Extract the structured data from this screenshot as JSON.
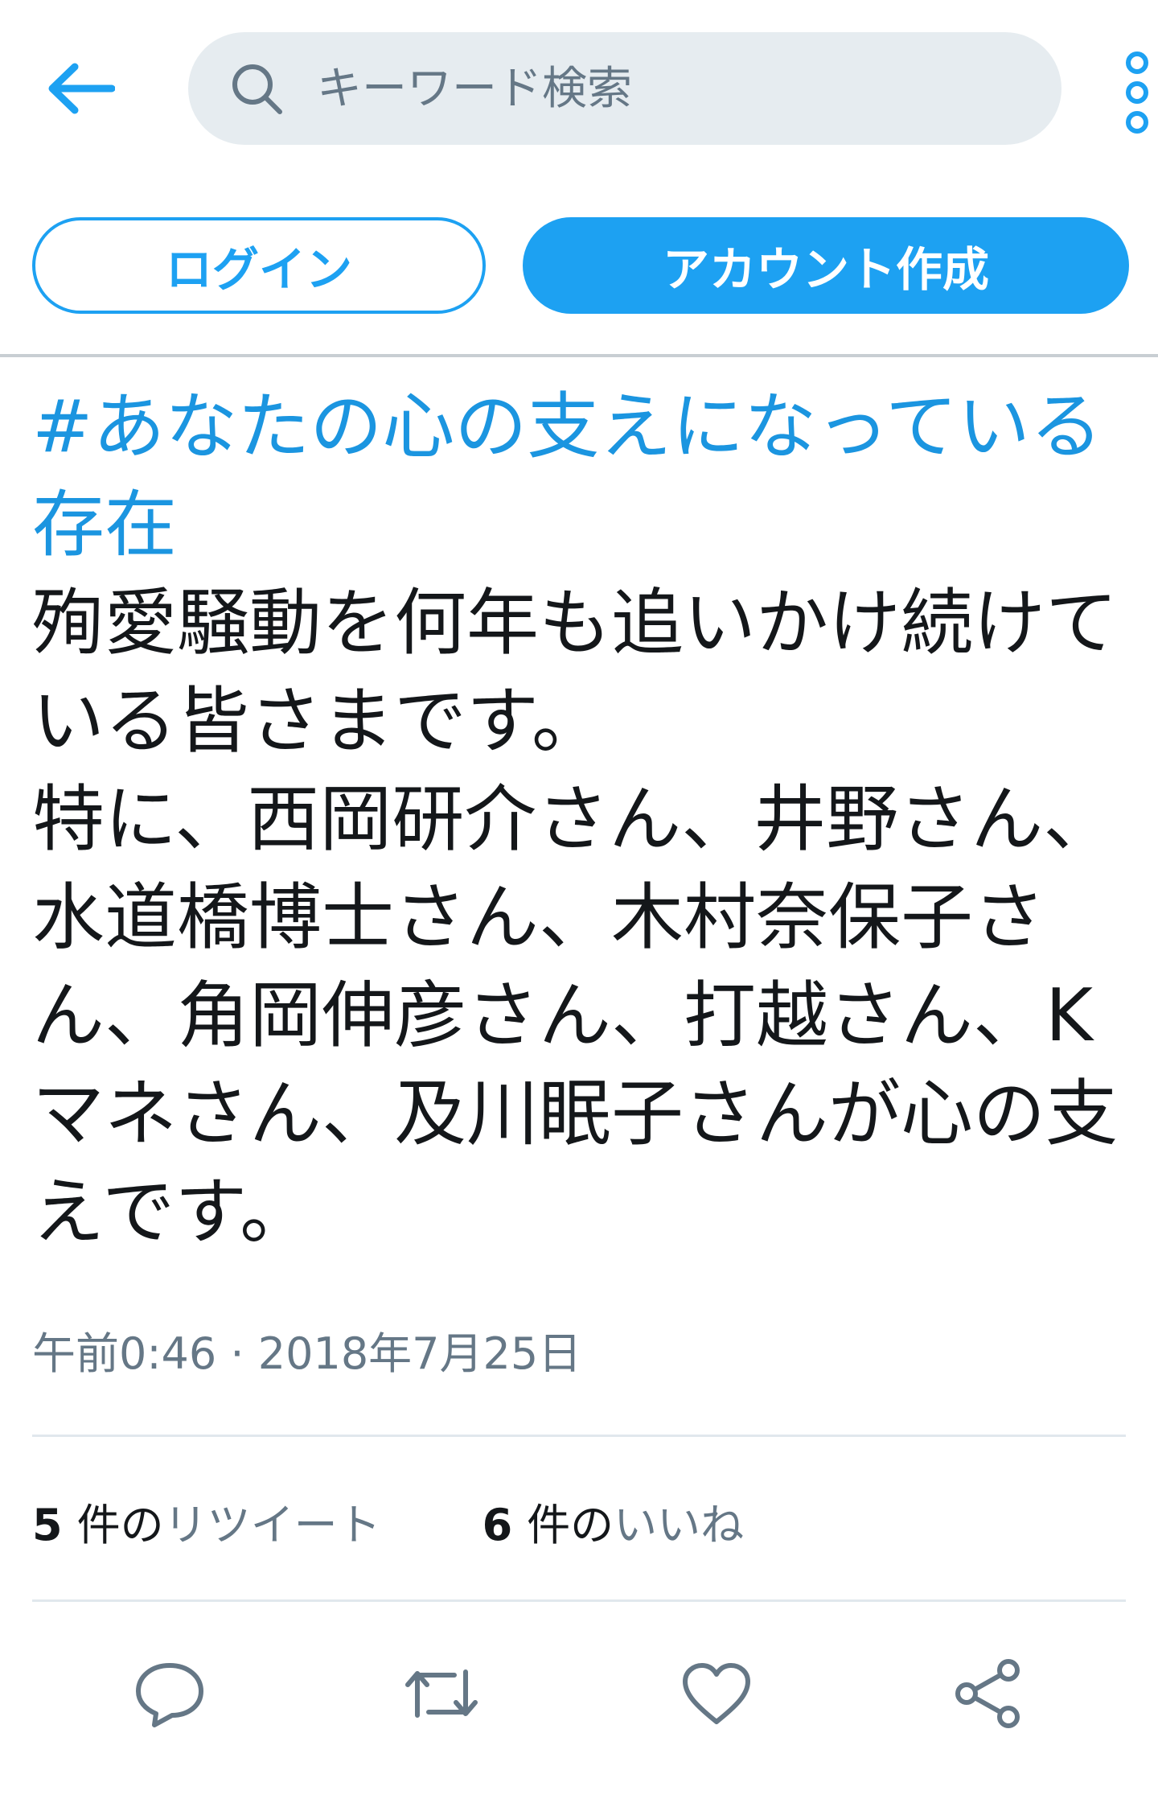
{
  "header": {
    "search_placeholder": "キーワード検索",
    "icons": {
      "back": "arrow-left-icon",
      "search": "search-icon",
      "more": "more-vertical-icon"
    }
  },
  "auth": {
    "login_label": "ログイン",
    "signup_label": "アカウント作成"
  },
  "tweet": {
    "hashtag": "#あなたの心の支えになっている存在",
    "body": "殉愛騒動を何年も追いかけ続けている皆さまです。\n特に、西岡研介さん、井野さん、水道橋博士さん、木村奈保子さん、角岡伸彦さん、打越さん、Kマネさん、及川眠子さんが心の支えです。",
    "timestamp": "午前0:46 · 2018年7月25日"
  },
  "stats": {
    "retweets_count": "5",
    "retweets_pre": "件の",
    "retweets_label": "リツイート",
    "likes_count": "6",
    "likes_pre": "件の",
    "likes_label": "いいね"
  },
  "actions": [
    "reply-icon",
    "retweet-icon",
    "like-icon",
    "share-icon"
  ],
  "colors": {
    "accent": "#1da1f2",
    "link": "#1b95e0",
    "muted": "#657786",
    "search_bg": "#e6ecf0"
  }
}
